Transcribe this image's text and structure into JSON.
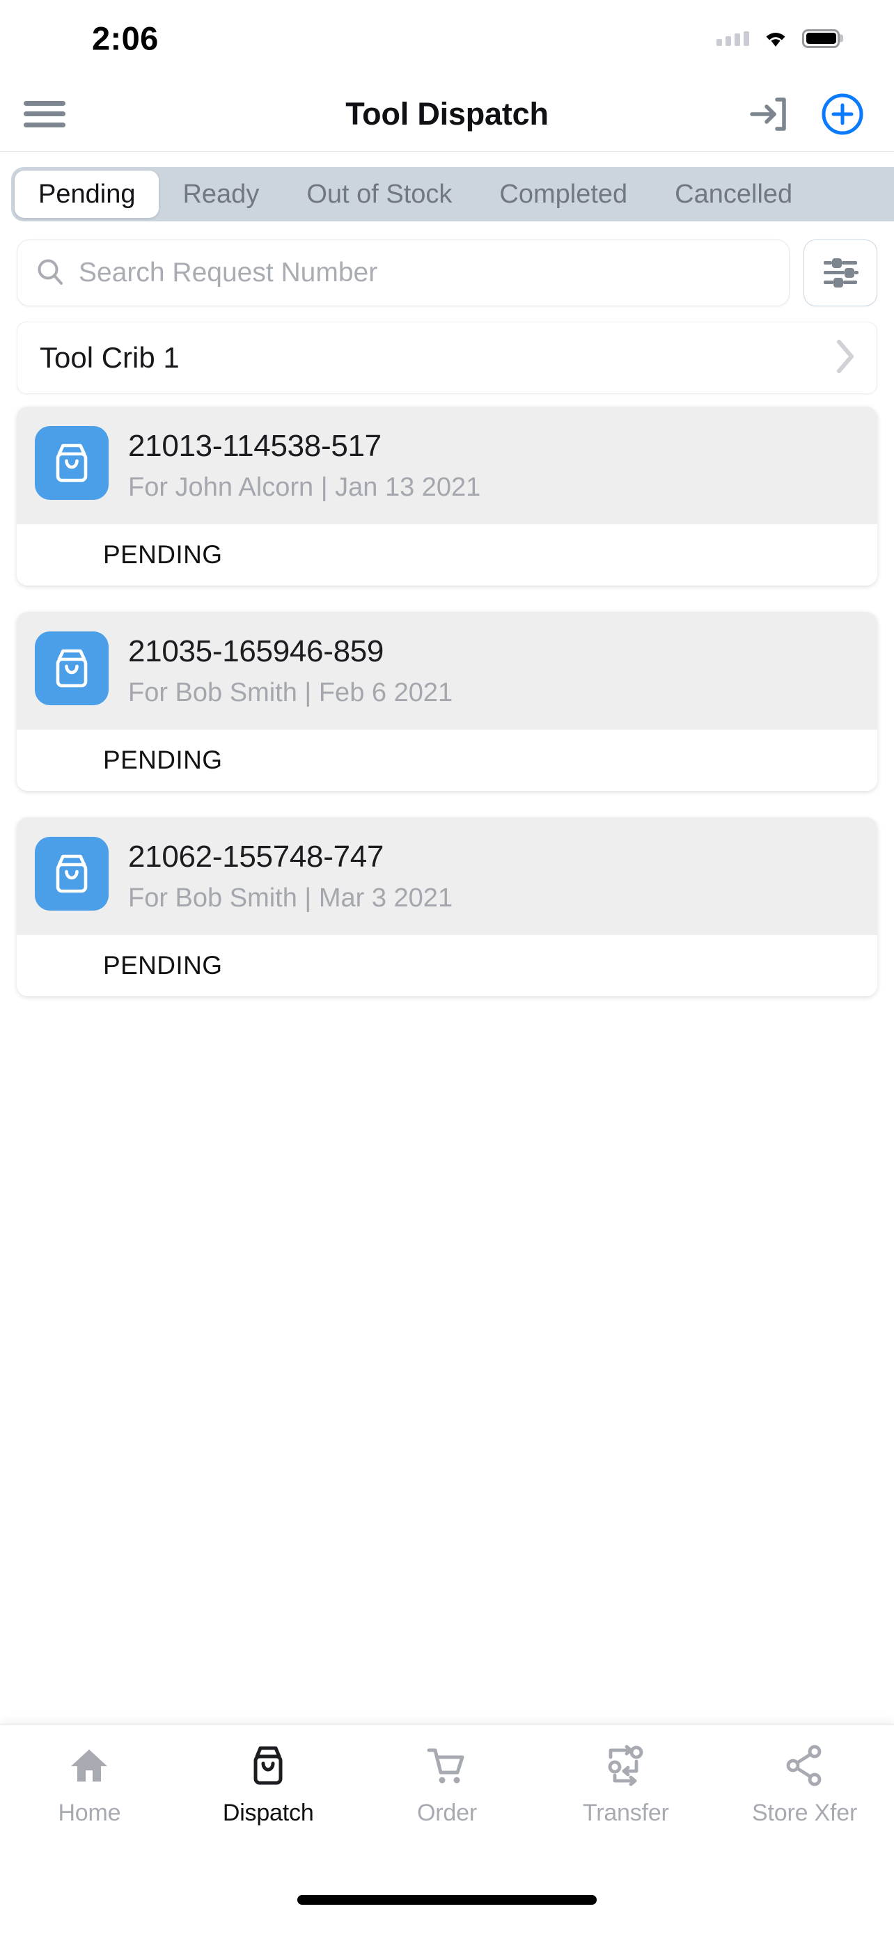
{
  "status_bar": {
    "time": "2:06",
    "signal_icon": "signal-dots-icon",
    "wifi_icon": "wifi-icon",
    "battery_icon": "battery-full-icon"
  },
  "header": {
    "menu_icon": "hamburger-menu-icon",
    "title": "Tool Dispatch",
    "login_icon": "sign-in-arrow-icon",
    "add_icon": "plus-circle-icon",
    "accent_color": "#0a7aff"
  },
  "tabs": {
    "selected": "Pending",
    "items": [
      {
        "label": "Pending"
      },
      {
        "label": "Ready"
      },
      {
        "label": "Out of Stock"
      },
      {
        "label": "Completed"
      },
      {
        "label": "Cancelled"
      }
    ]
  },
  "search": {
    "placeholder": "Search Request Number",
    "value": "",
    "icon": "search-icon",
    "filter_icon": "sliders-filter-icon"
  },
  "location": {
    "label": "Tool Crib 1",
    "chevron_icon": "chevron-right-icon"
  },
  "requests": [
    {
      "icon": "shopping-bag-icon",
      "icon_color": "#4a9fe8",
      "number": "21013-114538-517",
      "detail": "For John Alcorn | Jan 13 2021",
      "status": "PENDING"
    },
    {
      "icon": "shopping-bag-icon",
      "icon_color": "#4a9fe8",
      "number": "21035-165946-859",
      "detail": "For Bob Smith | Feb 6 2021",
      "status": "PENDING"
    },
    {
      "icon": "shopping-bag-icon",
      "icon_color": "#4a9fe8",
      "number": "21062-155748-747",
      "detail": "For Bob Smith | Mar 3 2021",
      "status": "PENDING"
    }
  ],
  "bottom_nav": {
    "selected": "Dispatch",
    "items": [
      {
        "label": "Home",
        "icon": "home-icon"
      },
      {
        "label": "Dispatch",
        "icon": "shopping-bag-icon"
      },
      {
        "label": "Order",
        "icon": "shopping-cart-icon"
      },
      {
        "label": "Transfer",
        "icon": "transfer-arrows-icon"
      },
      {
        "label": "Store Xfer",
        "icon": "share-nodes-icon"
      }
    ]
  }
}
